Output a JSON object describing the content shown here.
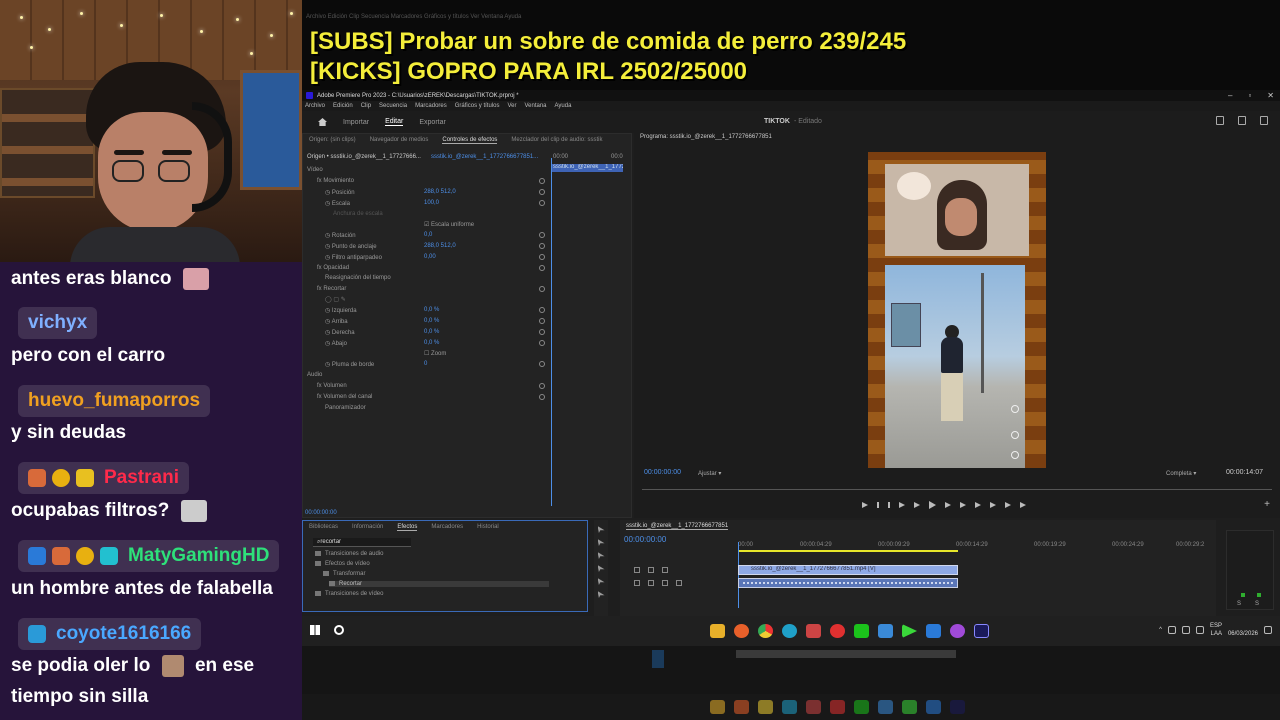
{
  "overlay": {
    "sub_line_1": "[SUBS] Probar un sobre de comida de perro 239/245",
    "sub_line_2": "[KICKS] GOPRO PARA IRL 2502/25000"
  },
  "chat": {
    "messages": [
      {
        "user": "",
        "text": "antes eras blanco",
        "user_color": ""
      },
      {
        "user": "vichyx",
        "text": "pero con el carro",
        "user_color": "#7fb0ff"
      },
      {
        "user": "huevo_fumaporros",
        "text": "y sin deudas",
        "user_color": "#f0a020"
      },
      {
        "user": "Pastrani",
        "text": "ocupabas filtros?",
        "user_color": "#ff2a4a"
      },
      {
        "user": "MatyGamingHD",
        "text": "un hombre antes de falabella",
        "user_color": "#2ee07a"
      },
      {
        "user": "coyote1616166",
        "text": "se podia oler lo",
        "text_after": "en ese",
        "text_line2": "tiempo sin silla",
        "user_color": "#4aa8ff"
      }
    ]
  },
  "premiere": {
    "title": "Adobe Premiere Pro 2023 - C:\\Usuarios\\zEREK\\Descargas\\TIKTOK.prproj *",
    "menu": [
      "Archivo",
      "Edición",
      "Clip",
      "Secuencia",
      "Marcadores",
      "Gráficos y títulos",
      "Ver",
      "Ventana",
      "Ayuda"
    ],
    "nav": {
      "import": "Importar",
      "edit": "Editar",
      "export": "Exportar",
      "project": "TIKTOK",
      "status": "- Editado"
    },
    "source_tabs": [
      "Origen: (sin clips)",
      "Navegador de medios",
      "Controles de efectos",
      "Mezclador del clip de audio: ssstik"
    ],
    "effect_controls": {
      "origin": "Origen • ssstik.io_@zerek__1_17727666...",
      "seq": "ssstik.io_@zerek__1_1772766677851...",
      "tc_start": "00:00",
      "tc_end": "00:0",
      "clip_label": "ssstik.io_@zerek__1_1772",
      "video_label": "Vídeo",
      "rows": [
        {
          "label": "Movimiento",
          "indent": 1
        },
        {
          "label": "Posición",
          "value": "288,0     512,0",
          "indent": 2
        },
        {
          "label": "Escala",
          "value": "100,0",
          "indent": 2
        },
        {
          "label": "Anchura de escala",
          "indent": 2,
          "dim": true
        },
        {
          "label": "Escala uniforme",
          "indent": 3,
          "checkbox": true
        },
        {
          "label": "Rotación",
          "value": "0,0",
          "indent": 2
        },
        {
          "label": "Punto de anclaje",
          "value": "288,0     512,0",
          "indent": 2
        },
        {
          "label": "Filtro antiparpadeo",
          "value": "0,00",
          "indent": 2
        },
        {
          "label": "Opacidad",
          "indent": 1
        },
        {
          "label": "Reasignación del tiempo",
          "indent": 1
        },
        {
          "label": "Recortar",
          "indent": 1
        },
        {
          "label": "Izquierda",
          "value": "0,0 %",
          "indent": 2
        },
        {
          "label": "Arriba",
          "value": "0,0 %",
          "indent": 2
        },
        {
          "label": "Derecha",
          "value": "0,0 %",
          "indent": 2
        },
        {
          "label": "Abajo",
          "value": "0,0 %",
          "indent": 2
        },
        {
          "label": "Zoom",
          "indent": 3,
          "checkbox": true
        },
        {
          "label": "Pluma de borde",
          "value": "0",
          "indent": 2
        },
        {
          "label": "Audio",
          "indent": 0
        },
        {
          "label": "Volumen",
          "indent": 1
        },
        {
          "label": "Volumen del canal",
          "indent": 1
        },
        {
          "label": "Panoramizador",
          "indent": 1
        }
      ],
      "footer_tc": "00:00:00:00"
    },
    "program": {
      "label": "Programa: ssstik.io_@zerek__1_1772766677851",
      "timecode": "00:00:00:00",
      "fit": "Ajustar",
      "quality": "Completa",
      "duration": "00:00:14:07"
    },
    "effects_panel": {
      "tabs": [
        "Bibliotecas",
        "Información",
        "Efectos",
        "Marcadores",
        "Historial"
      ],
      "search_value": "recortar",
      "tree": [
        "Transiciones de audio",
        "Efectos de vídeo",
        "Transformar",
        "Recortar",
        "Transiciones de vídeo"
      ]
    },
    "timeline": {
      "tab": "ssstik.io_@zerek__1_1772766677851",
      "timecode": "00:00:00:00",
      "times": [
        "00:00",
        "00:00:04:29",
        "00:00:09:29",
        "00:00:14:29",
        "00:00:19:29",
        "00:00:24:29",
        "00:00:29:2"
      ],
      "v1_clip": "ssstik.io_@zerek__1_1772766677851.mp4 [V]",
      "meter_labels": [
        "S",
        "S"
      ]
    }
  },
  "taskbar": {
    "lang_top": "ESP",
    "lang_bottom": "LAA",
    "date": "06/03/2026"
  },
  "colors": {
    "chat_bg": "#26143a",
    "subs_yellow": "#f4ee3a",
    "premiere_blue": "#4d8fe8"
  }
}
